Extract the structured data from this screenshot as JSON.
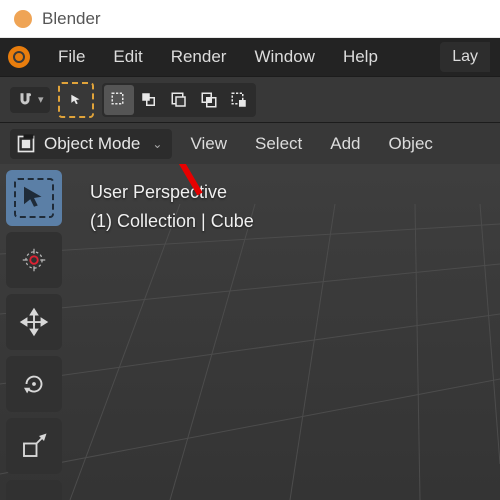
{
  "title": "Blender",
  "menubar": {
    "items": [
      "File",
      "Edit",
      "Render",
      "Window",
      "Help"
    ]
  },
  "workspace": {
    "tab0": "Lay"
  },
  "header2": {
    "mode": "Object Mode",
    "items": [
      "View",
      "Select",
      "Add",
      "Objec"
    ]
  },
  "overlay": {
    "line1": "User Perspective",
    "line2": "(1) Collection | Cube"
  },
  "icons": {
    "cursor": "cursor-icon",
    "move": "move-icon",
    "rotate": "rotate-icon",
    "scale": "scale-icon",
    "select": "select-box-icon"
  }
}
